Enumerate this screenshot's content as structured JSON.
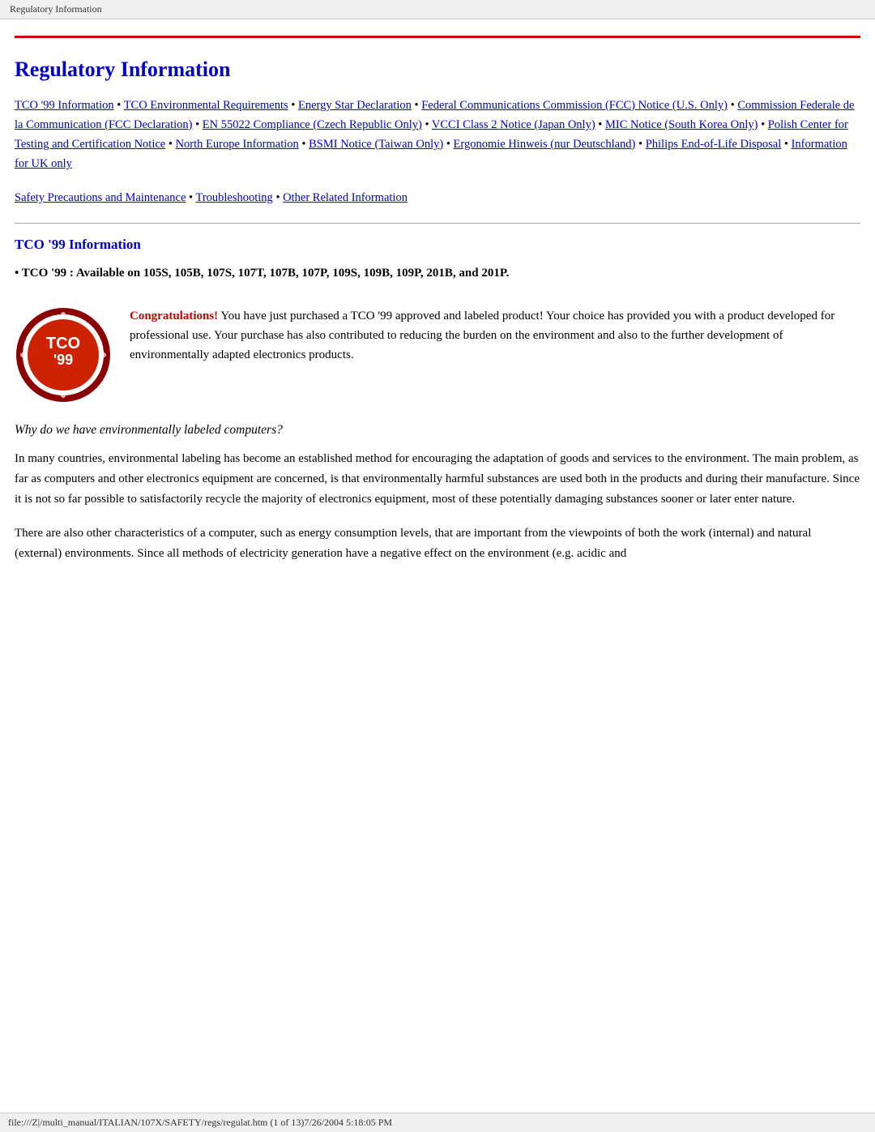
{
  "browser_tab": {
    "label": "Regulatory Information"
  },
  "page_title": "Regulatory Information",
  "nav_links": [
    {
      "text": "TCO '99 Information",
      "id": "tco99"
    },
    {
      "text": "TCO Environmental Requirements",
      "id": "tcoenv"
    },
    {
      "text": "Energy Star Declaration",
      "id": "energystar"
    },
    {
      "text": "Federal Communications Commission (FCC) Notice (U.S. Only)",
      "id": "fcc"
    },
    {
      "text": "Commission Federale de la Communication (FCC Declaration)",
      "id": "fccfr"
    },
    {
      "text": "EN 55022 Compliance (Czech Republic Only)",
      "id": "en55022"
    },
    {
      "text": "VCCI Class 2 Notice (Japan Only)",
      "id": "vcci"
    },
    {
      "text": "MIC Notice (South Korea Only)",
      "id": "mic"
    },
    {
      "text": "Polish Center for Testing and Certification Notice",
      "id": "polish"
    },
    {
      "text": "North Europe Information",
      "id": "northeurope"
    },
    {
      "text": "BSMI Notice (Taiwan Only)",
      "id": "bsmi"
    },
    {
      "text": "Ergonomie Hinweis (nur Deutschland)",
      "id": "ergonomie"
    },
    {
      "text": "Philips End-of-Life Disposal",
      "id": "philips"
    },
    {
      "text": "Information for UK only",
      "id": "uk"
    }
  ],
  "bottom_nav_links": [
    {
      "text": "Safety Precautions and Maintenance",
      "id": "safety"
    },
    {
      "text": "Troubleshooting",
      "id": "trouble"
    },
    {
      "text": "Other Related Information",
      "id": "other"
    }
  ],
  "tco_section": {
    "title": "TCO '99 Information",
    "models_label": "• TCO '99 : Available on 105S, 105B, 107S, 107T, 107B, 107P, 109S, 109B, 109P, 201B, and 201P.",
    "congrats_label": "Congratulations!",
    "congrats_text": " You have just purchased a TCO '99 approved and labeled product! Your choice has provided you with a product developed for professional use. Your purchase has also contributed to reducing the burden on the environment and also to the further development of environmentally adapted electronics products.",
    "italic_heading": "Why do we have environmentally labeled computers?",
    "paragraph1": "In many countries, environmental labeling has become an established method for encouraging the adaptation of goods and services to the environment. The main problem, as far as computers and other electronics equipment are concerned, is that environmentally harmful substances are used both in the products and during their manufacture. Since it is not so far possible to satisfactorily recycle the majority of electronics equipment, most of these potentially damaging substances sooner or later enter nature.",
    "paragraph2": "There are also other characteristics of a computer, such as energy consumption levels, that are important from the viewpoints of both the work (internal) and natural (external) environments. Since all methods of electricity generation have a negative effect on the environment (e.g. acidic and"
  },
  "status_bar": {
    "text": "file:///Z|/multi_manual/ITALIAN/107X/SAFETY/regs/regulat.htm (1 of 13)7/26/2004 5:18:05 PM"
  },
  "colors": {
    "red": "#cc0000",
    "blue": "#0000cc",
    "gray_line": "#aaaaaa"
  }
}
